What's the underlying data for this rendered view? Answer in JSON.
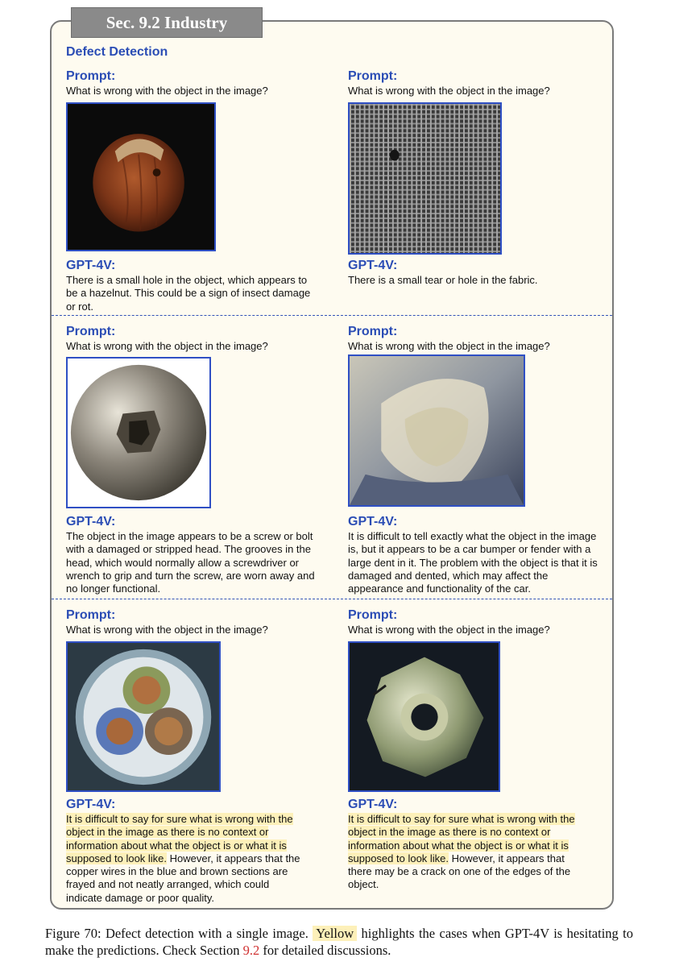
{
  "section_tab": "Sec. 9.2 Industry",
  "section_title": "Defect Detection",
  "colors": {
    "accent": "#2b4db5",
    "highlight": "#fdf0b9",
    "panel": "#fefbf0",
    "ref": "#d03030"
  },
  "prompt_label": "Prompt:",
  "gpt_label": "GPT-4V:",
  "cases": [
    {
      "prompt": "What is wrong with the object in the image?",
      "image": "hazelnut-with-hole",
      "answer_highlight": "",
      "answer": "There is a small hole in the object, which appears to be a hazelnut. This could be a sign of insect damage or rot."
    },
    {
      "prompt": "What is wrong with the object in the image?",
      "image": "fabric-with-tear",
      "answer_highlight": "",
      "answer": "There is a small tear or hole in the fabric."
    },
    {
      "prompt": "What is wrong with the object in the image?",
      "image": "screw-head-stripped",
      "answer_highlight": "",
      "answer": "The object in the image appears to be a screw or bolt with a damaged or stripped head. The grooves in the head, which would normally allow a screwdriver or wrench to grip and turn the screw, are worn away and no longer functional."
    },
    {
      "prompt": "What is wrong with the object in the image?",
      "image": "dented-transparent-part",
      "answer_highlight": "",
      "answer": "It is difficult to tell exactly what the object in the image is, but it appears to be a car bumper or fender with a large dent in it. The problem with the object is that it is damaged and dented, which may affect the appearance and functionality of the car."
    },
    {
      "prompt": "What is wrong with the object in the image?",
      "image": "cable-cross-section",
      "answer_highlight": "It is difficult to say for sure what is wrong with the object in the image as there is no context or information about what the object is or what it is supposed to look like.",
      "answer": " However, it appears that the copper wires in the blue and brown sections are frayed and not neatly arranged, which could indicate damage or poor quality."
    },
    {
      "prompt": "What is wrong with the object in the image?",
      "image": "metal-nut-cracked",
      "answer_highlight": "It is difficult to say for sure what is wrong with the object in the image as there is no context or information about what the object is or what it is supposed to look like.",
      "answer": " However, it appears that there may be a crack on one of the edges of the object."
    }
  ],
  "caption": {
    "prefix": "Figure 70: Defect detection with a single image.",
    "yellow": "Yellow",
    "middle": "highlights the cases when GPT-4V is hesitating to make the predictions. Check Section",
    "ref": "9.2",
    "suffix": "for detailed discussions."
  }
}
